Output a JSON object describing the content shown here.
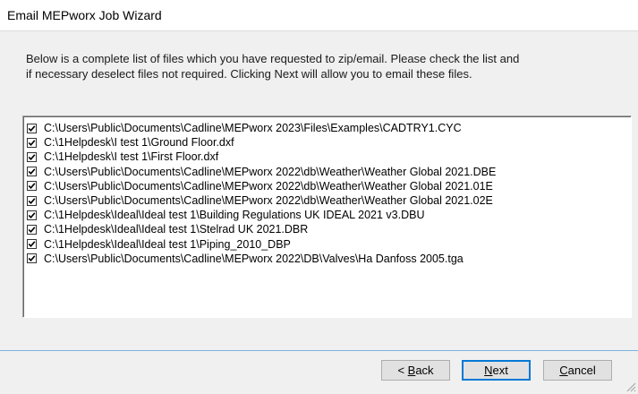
{
  "window": {
    "title": "Email MEPworx Job Wizard"
  },
  "instructions": {
    "line1": "Below is a complete list of files which you have requested to zip/email.  Please check the list and",
    "line2": "if necessary deselect files not required.  Clicking Next will allow you to email these files."
  },
  "files": [
    {
      "path": "C:\\Users\\Public\\Documents\\Cadline\\MEPworx 2023\\Files\\Examples\\CADTRY1.CYC",
      "checked": true
    },
    {
      "path": "C:\\1Helpdesk\\I test 1\\Ground Floor.dxf",
      "checked": true
    },
    {
      "path": "C:\\1Helpdesk\\I test 1\\First Floor.dxf",
      "checked": true
    },
    {
      "path": "C:\\Users\\Public\\Documents\\Cadline\\MEPworx 2022\\db\\Weather\\Weather Global 2021.DBE",
      "checked": true
    },
    {
      "path": "C:\\Users\\Public\\Documents\\Cadline\\MEPworx 2022\\db\\Weather\\Weather Global 2021.01E",
      "checked": true
    },
    {
      "path": "C:\\Users\\Public\\Documents\\Cadline\\MEPworx 2022\\db\\Weather\\Weather Global 2021.02E",
      "checked": true
    },
    {
      "path": "C:\\1Helpdesk\\Ideal\\Ideal test 1\\Building Regulations UK IDEAL 2021 v3.DBU",
      "checked": true
    },
    {
      "path": "C:\\1Helpdesk\\Ideal\\Ideal test 1\\Stelrad UK 2021.DBR",
      "checked": true
    },
    {
      "path": "C:\\1Helpdesk\\Ideal\\Ideal test 1\\Piping_2010_DBP",
      "checked": true
    },
    {
      "path": "C:\\Users\\Public\\Documents\\Cadline\\MEPworx 2022\\DB\\Valves\\Ha Danfoss 2005.tga",
      "checked": true
    }
  ],
  "buttons": {
    "back": {
      "prefix": "< ",
      "mnemonic": "B",
      "rest": "ack"
    },
    "next": {
      "prefix": "",
      "mnemonic": "N",
      "rest": "ext"
    },
    "cancel": {
      "prefix": "",
      "mnemonic": "C",
      "rest": "ancel"
    }
  },
  "colors": {
    "default_button_border": "#0078d7",
    "separator": "#7fb2e0"
  }
}
